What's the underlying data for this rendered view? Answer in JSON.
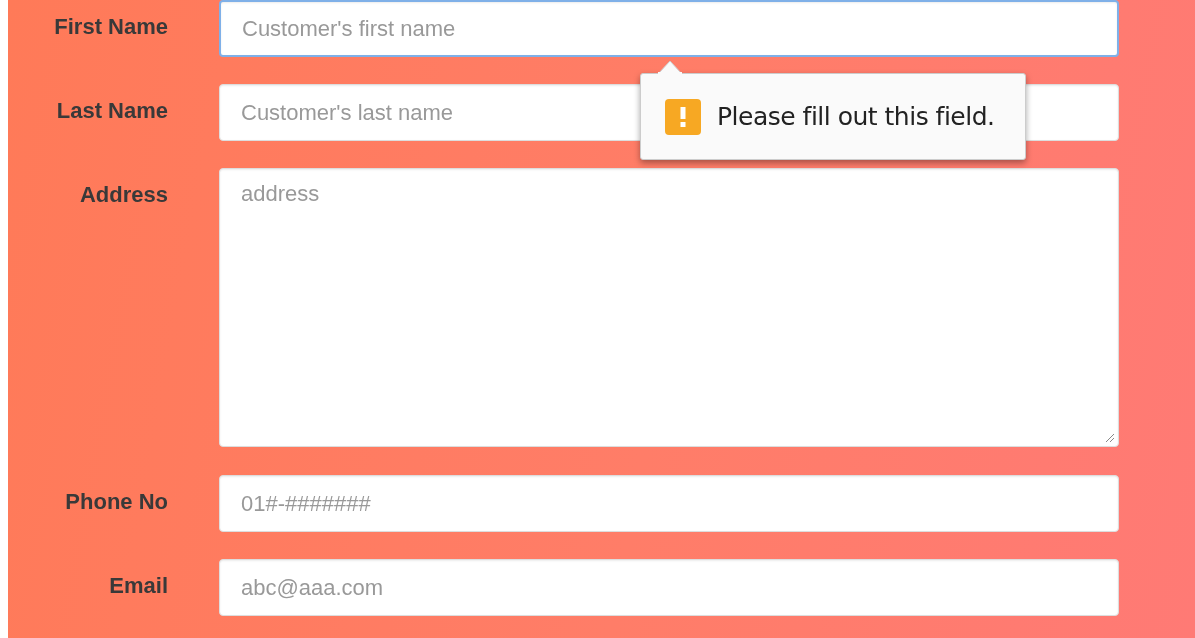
{
  "fields": [
    {
      "label": "First Name",
      "kind": "input",
      "placeholder": "Customer's first name",
      "focused": true,
      "validation_message": "Please fill out this field."
    },
    {
      "label": "Last Name",
      "kind": "input",
      "placeholder": "Customer's last name",
      "focused": false
    },
    {
      "label": "Address",
      "kind": "textarea",
      "placeholder": "address",
      "focused": false
    },
    {
      "label": "Phone No",
      "kind": "input",
      "placeholder": "01#-#######",
      "focused": false
    },
    {
      "label": "Email",
      "kind": "input",
      "placeholder": "abc@aaa.com",
      "focused": false
    }
  ]
}
